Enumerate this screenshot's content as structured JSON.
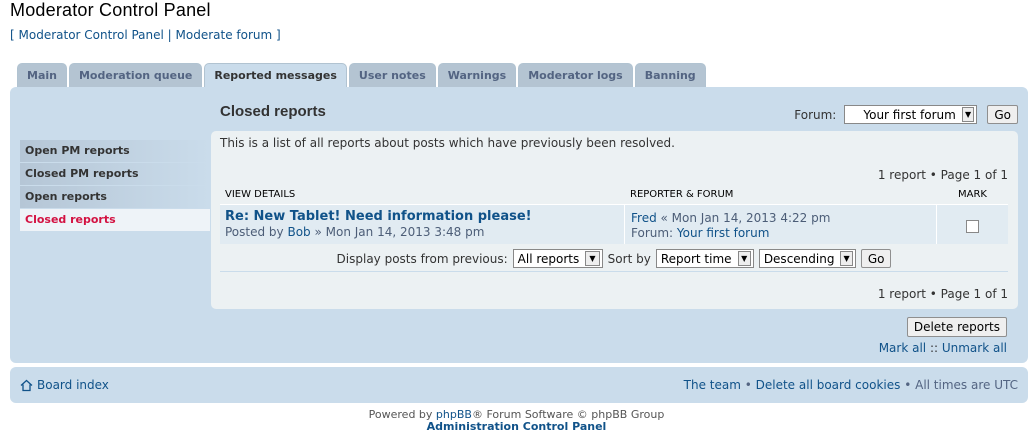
{
  "page": {
    "title": "Moderator Control Panel",
    "breadcrumb_open": "[ ",
    "breadcrumb_mcp": "Moderator Control Panel",
    "breadcrumb_sep": " | ",
    "breadcrumb_moderate": "Moderate forum",
    "breadcrumb_close": " ]"
  },
  "tabs": [
    {
      "label": "Main",
      "active": false
    },
    {
      "label": "Moderation queue",
      "active": false
    },
    {
      "label": "Reported messages",
      "active": true
    },
    {
      "label": "User notes",
      "active": false
    },
    {
      "label": "Warnings",
      "active": false
    },
    {
      "label": "Moderator logs",
      "active": false
    },
    {
      "label": "Banning",
      "active": false
    }
  ],
  "sidebar": {
    "items": [
      {
        "label": "Open PM reports",
        "active": false
      },
      {
        "label": "Closed PM reports",
        "active": false
      },
      {
        "label": "Open reports",
        "active": false
      },
      {
        "label": "Closed reports",
        "active": true
      }
    ]
  },
  "content": {
    "title": "Closed reports",
    "forum_label": "Forum:",
    "forum_selected": "Your first forum",
    "go_label": "Go",
    "description": "This is a list of all reports about posts which have previously been resolved.",
    "pagination": "1 report • Page 1 of 1"
  },
  "table": {
    "headers": {
      "details": "View details",
      "reporter": "Reporter & Forum",
      "mark": "Mark"
    },
    "rows": [
      {
        "topic": "Re: New Tablet! Need information please!",
        "posted_by_prefix": "Posted by ",
        "author": "Bob",
        "posted_time": " » Mon Jan 14, 2013 3:48 pm",
        "reporter": "Fred",
        "reported_time": " « Mon Jan 14, 2013 4:22 pm",
        "forum_prefix": "Forum: ",
        "forum": "Your first forum"
      }
    ]
  },
  "filters": {
    "display_label": "Display posts from previous:",
    "display_value": "All reports",
    "sort_label": "Sort by",
    "sort_key": "Report time",
    "sort_dir": "Descending",
    "go_label": "Go"
  },
  "actions": {
    "delete_label": "Delete reports",
    "mark_all": "Mark all",
    "mark_sep": " :: ",
    "unmark_all": "Unmark all"
  },
  "footer": {
    "board_index": "Board index",
    "team": "The team",
    "bullet": " • ",
    "delete_cookies": "Delete all board cookies",
    "timezone": "All times are UTC",
    "powered_prefix": "Powered by ",
    "phpbb": "phpBB",
    "powered_suffix": "® Forum Software © phpBB Group",
    "acp": "Administration Control Panel"
  }
}
